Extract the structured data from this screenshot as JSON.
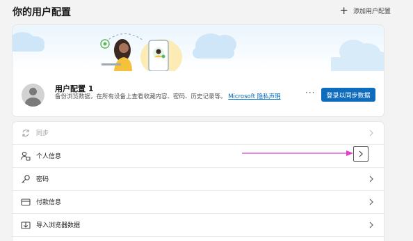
{
  "header": {
    "title": "你的用户配置",
    "add_profile_label": "添加用户配置"
  },
  "profile": {
    "name": "用户配置 1",
    "description": "备份浏览数据，在所有设备上查看收藏内容、密码、历史记录等。",
    "privacy_link": "Microsoft 隐私声明",
    "more_label": "···",
    "sync_button": "登录以同步数据"
  },
  "settings": {
    "items": [
      {
        "label": "同步",
        "icon": "sync-icon",
        "enabled": false
      },
      {
        "label": "个人信息",
        "icon": "person-info-icon",
        "enabled": true
      },
      {
        "label": "密码",
        "icon": "key-icon",
        "enabled": true
      },
      {
        "label": "付款信息",
        "icon": "credit-card-icon",
        "enabled": true
      },
      {
        "label": "导入浏览器数据",
        "icon": "import-icon",
        "enabled": true
      }
    ]
  },
  "colors": {
    "accent": "#0f6cbd",
    "link": "#0067c0",
    "annotation_arrow": "#e040c8"
  }
}
